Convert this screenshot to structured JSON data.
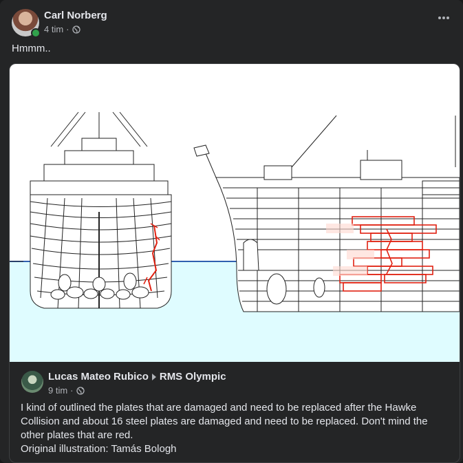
{
  "post": {
    "author": "Carl Norberg",
    "time": "4 tim",
    "separator": "·",
    "text": "Hmmm.."
  },
  "shared": {
    "author": "Lucas Mateo Rubico",
    "group": "RMS Olympic",
    "time": "9 tim",
    "separator": "·",
    "text": "I kind of outlined the plates that are damaged and need to be replaced after the Hawke Collision and about 16 steel plates are damaged and need to be replaced. Don't mind the other plates that are red.",
    "credit": "Original illustration: Tamás Bologh"
  },
  "icons": {
    "more": "more-horizontal-icon",
    "privacy": "globe-icon"
  },
  "colors": {
    "background": "#242526",
    "text": "#e4e6eb",
    "muted": "#b0b3b8",
    "online": "#31a24c",
    "water": "#dffcff",
    "waterline": "#2f5fb0",
    "damage": "#e02010"
  }
}
